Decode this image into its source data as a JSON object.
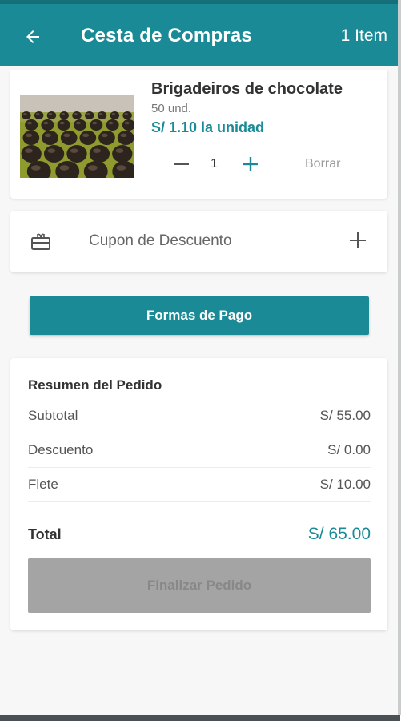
{
  "header": {
    "title": "Cesta de Compras",
    "item_count": "1 Item",
    "back_icon": "arrow-left-icon"
  },
  "product": {
    "name": "Brigadeiros de chocolate",
    "units": "50 und.",
    "unit_price": "S/ 1.10 la unidad",
    "quantity": "1",
    "delete_label": "Borrar",
    "image": "chocolate-brigadeiros-photo"
  },
  "coupon": {
    "label": "Cupon de Descuento",
    "icon": "gift-card-icon",
    "action_icon": "plus-icon"
  },
  "payment_button": "Formas de Pago",
  "summary": {
    "title": "Resumen del Pedido",
    "rows": [
      {
        "label": "Subtotal",
        "value": "S/ 55.00"
      },
      {
        "label": "Descuento",
        "value": "S/ 0.00"
      },
      {
        "label": "Flete",
        "value": "S/ 10.00"
      }
    ],
    "total_label": "Total",
    "total_value": "S/ 65.00",
    "finalize_button": "Finalizar Pedido"
  },
  "colors": {
    "primary": "#1a8a96",
    "disabled": "#a4a4a4"
  }
}
